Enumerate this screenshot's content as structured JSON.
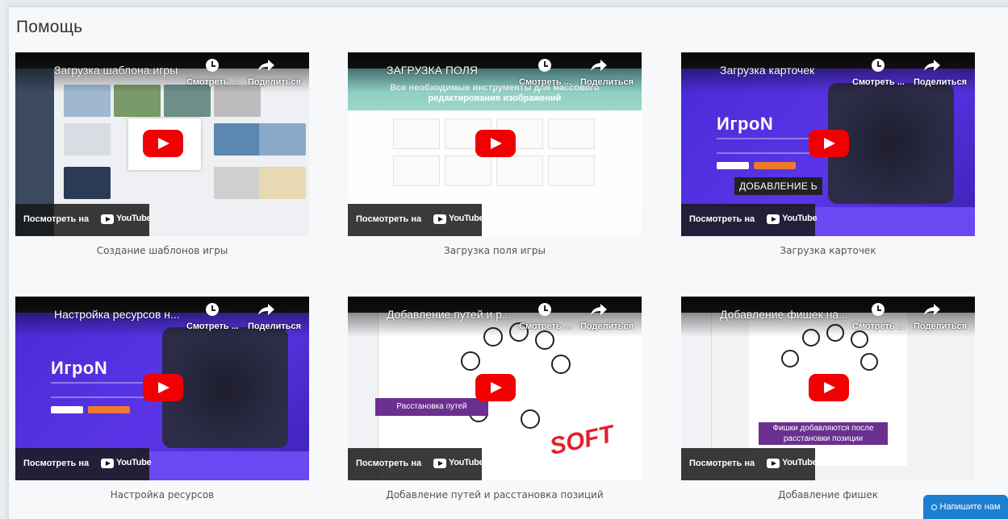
{
  "page": {
    "title": "Помощь"
  },
  "overlay": {
    "watch_label": "Смотреть ...",
    "share_label": "Поделиться",
    "watch_on": "Посмотреть на",
    "youtube": "YouTube"
  },
  "videos": [
    {
      "title": "Загрузка шаблона игры",
      "caption": "Создание шаблонов игры"
    },
    {
      "title": "ЗАГРУЗКА ПОЛЯ",
      "caption": "Загрузка поля игры",
      "hero_text": "Все необходимые инструменты для массового редактирования изображений"
    },
    {
      "title": "Загрузка карточек",
      "caption": "Загрузка карточек",
      "brand": "ИгроN",
      "badge": "ДОБАВЛЕНИЕ Ь"
    },
    {
      "title": "Настройка ресурсов н...",
      "caption": "Настройка ресурсов",
      "brand": "ИгроN"
    },
    {
      "title": "Добавление путей и р...",
      "caption": "Добавление путей и расстановка позиций",
      "ribbon": "Расстановка путей",
      "stamp": "SOFT"
    },
    {
      "title": "Добавление фишек на...",
      "caption": "Добавление фишек",
      "ribbon": "Фишки добавляются после расстановки позиции"
    }
  ],
  "chat": {
    "label": "Напишите нам"
  },
  "colors": {
    "accent": "#1d7fd1",
    "play": "#f00000",
    "brand_purple": "#4a2bd6"
  }
}
